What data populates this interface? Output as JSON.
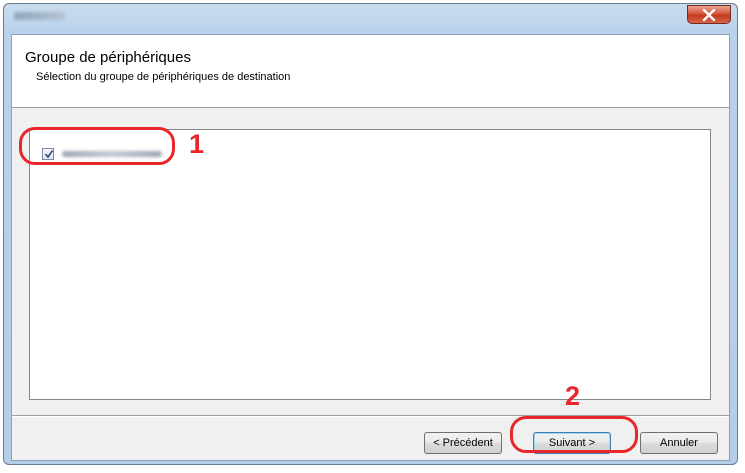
{
  "window": {
    "close_icon": "close-x-icon"
  },
  "header": {
    "title": "Groupe de périphériques",
    "subtitle": "Sélection du groupe de périphériques de destination"
  },
  "list": {
    "items": [
      {
        "checked": true
      }
    ]
  },
  "buttons": {
    "previous": "< Précédent",
    "next": "Suivant >",
    "cancel": "Annuler"
  },
  "callouts": {
    "one": "1",
    "two": "2",
    "color": "#e8262b"
  }
}
